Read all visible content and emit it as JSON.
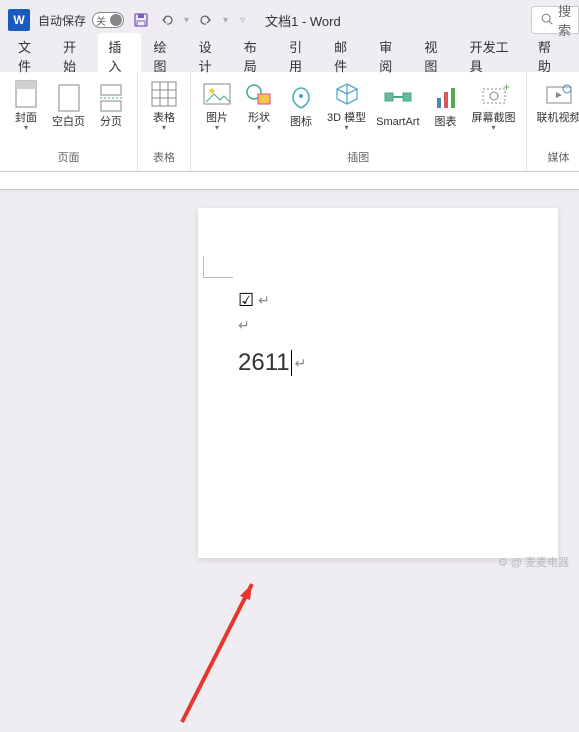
{
  "titleBar": {
    "autosaveLabel": "自动保存",
    "toggleState": "关",
    "docTitle": "文档1 - Word",
    "searchPlaceholder": "搜索"
  },
  "tabs": {
    "file": "文件",
    "home": "开始",
    "insert": "插入",
    "draw": "绘图",
    "design": "设计",
    "layout": "布局",
    "references": "引用",
    "mailings": "邮件",
    "review": "审阅",
    "view": "视图",
    "developer": "开发工具",
    "help": "帮助"
  },
  "ribbon": {
    "page": {
      "cover": "封面",
      "blank": "空白页",
      "break": "分页",
      "groupLabel": "页面"
    },
    "table": {
      "label": "表格",
      "groupLabel": "表格"
    },
    "illus": {
      "picture": "图片",
      "shapes": "形状",
      "icons": "图标",
      "model3d": "3D 模型",
      "smartart": "SmartArt",
      "chart": "图表",
      "screenshot": "屏幕截图",
      "groupLabel": "插图"
    },
    "media": {
      "video": "联机视频",
      "groupLabel": "媒体"
    }
  },
  "document": {
    "checkSymbol": "☑",
    "typedText": "2611"
  },
  "watermark": "⚙ @ 麦麦电器"
}
